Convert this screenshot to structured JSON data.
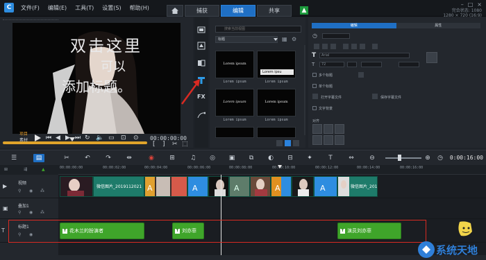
{
  "app": {
    "menu": [
      "文件(F)",
      "编辑(E)",
      "工具(T)",
      "设置(S)",
      "帮助(H)"
    ],
    "tabs": [
      {
        "label": "捕获",
        "active": false
      },
      {
        "label": "编辑",
        "active": true
      },
      {
        "label": "共享",
        "active": false
      }
    ],
    "resolution_line1": "完合状态: 1080",
    "resolution_line2": "1280 × 720 (16:9)"
  },
  "player": {
    "overlay_text": [
      "双击这里",
      "可以",
      "添加标题。"
    ],
    "project_label": "项目",
    "clip_label": "素材",
    "timecode": "00:00:00:00"
  },
  "library": {
    "search_placeholder": "搜索当前视图",
    "filter_value": "标题",
    "thumbs": [
      {
        "label": "Lorem ipsum",
        "caption": "Lorem ipsum"
      },
      {
        "label": "Lorem ipsu",
        "caption": "Lorem ipsum"
      },
      {
        "label": "Lorem ipsum",
        "caption": "Lorem ipsum"
      },
      {
        "label": "Lorem ipsum",
        "caption": "Lorem ipsum"
      }
    ],
    "side_icons": [
      "media-icon",
      "instant-project-icon",
      "transition-icon",
      "title-icon",
      "fx-icon",
      "path-icon"
    ]
  },
  "options": {
    "tabs": [
      {
        "label": "编辑",
        "active": true
      },
      {
        "label": "属性",
        "active": false
      }
    ],
    "font_placeholder": "Arial",
    "size_value": "72",
    "checkbox_multi": "多个标题",
    "checkbox_single": "单个标题",
    "apply_label": "应用标题",
    "save_label": "保存字幕文件",
    "open_label": "打开字幕文件",
    "text_bg_label": "文字背景",
    "align_label": "对齐"
  },
  "timeline": {
    "timecode": "0:00:16:00",
    "ruler_ticks": [
      "00:00:00:00",
      "00:00:02:00",
      "00:00:04:00",
      "00:00:06:00",
      "00:00:08:00",
      "00:00:10:00",
      "00:00:12:00",
      "00:00:14:00",
      "00:00:16:00"
    ],
    "tracks": [
      {
        "name": "视频"
      },
      {
        "name": "叠加1"
      },
      {
        "name": "标题1"
      }
    ],
    "video_clips": [
      {
        "label": "微信图片_2019112021"
      },
      {
        "label": "微信图片_201"
      }
    ],
    "title_clips": [
      {
        "label": "花木兰的扮演者"
      },
      {
        "label": "刘亦菲"
      },
      {
        "label": "演员刘亦菲"
      }
    ]
  },
  "watermark": {
    "text": "系统天地"
  }
}
